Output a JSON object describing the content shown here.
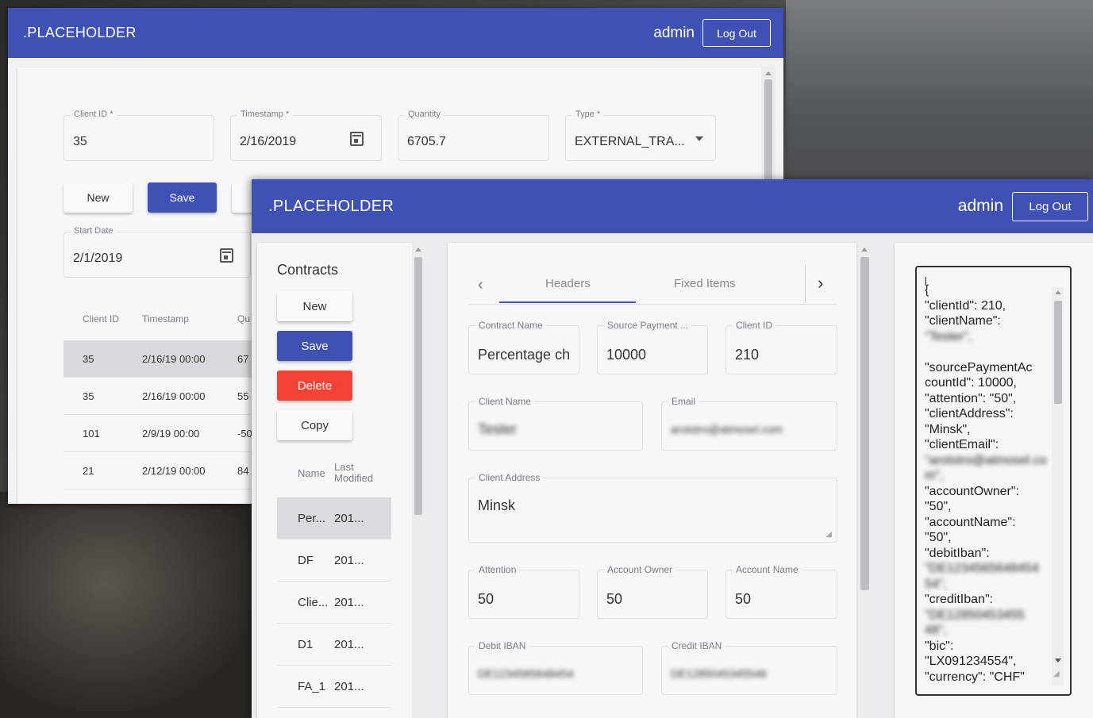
{
  "app": {
    "brand": ".PLACEHOLDER",
    "user": "admin",
    "logout_label": "Log Out"
  },
  "back": {
    "fields": {
      "client_id": {
        "label": "Client ID *",
        "value": "35"
      },
      "timestamp": {
        "label": "Timestamp *",
        "value": "2/16/2019"
      },
      "quantity": {
        "label": "Quantity",
        "value": "6705.7"
      },
      "type": {
        "label": "Type *",
        "value": "EXTERNAL_TRA..."
      },
      "start_date": {
        "label": "Start Date",
        "value": "2/1/2019"
      }
    },
    "buttons": {
      "new": "New",
      "save": "Save"
    },
    "table": {
      "headers": [
        "Client ID",
        "Timestamp",
        "Qu"
      ],
      "rows": [
        [
          "35",
          "2/16/19 00:00",
          "67"
        ],
        [
          "35",
          "2/16/19 00:00",
          "55"
        ],
        [
          "101",
          "2/9/19 00:00",
          "-50"
        ],
        [
          "21",
          "2/12/19 00:00",
          "84"
        ]
      ]
    }
  },
  "front": {
    "contracts": {
      "title": "Contracts",
      "buttons": {
        "new": "New",
        "save": "Save",
        "delete": "Delete",
        "copy": "Copy"
      },
      "headers": {
        "name": "Name",
        "last_modified_1": "Last",
        "last_modified_2": "Modified"
      },
      "rows": [
        [
          "Per...",
          "201..."
        ],
        [
          "DF",
          "201..."
        ],
        [
          "Clie...",
          "201..."
        ],
        [
          "D1",
          "201..."
        ],
        [
          "FA_1",
          "201..."
        ]
      ]
    },
    "tabs": {
      "headers": "Headers",
      "fixed_items": "Fixed Items"
    },
    "form": {
      "contract_name": {
        "label": "Contract Name",
        "value": "Percentage chi"
      },
      "source_payment": {
        "label": "Source Payment ...",
        "value": "10000"
      },
      "client_id": {
        "label": "Client ID",
        "value": "210"
      },
      "client_name": {
        "label": "Client Name",
        "value": "Tester"
      },
      "email": {
        "label": "Email",
        "value": "arotstro@atmosel.com"
      },
      "client_address": {
        "label": "Client Address",
        "value": "Minsk"
      },
      "attention": {
        "label": "Attention",
        "value": "50"
      },
      "account_owner": {
        "label": "Account Owner",
        "value": "50"
      },
      "account_name": {
        "label": "Account Name",
        "value": "50"
      },
      "debit_iban": {
        "label": "Debit IBAN",
        "value": "DE1234565648454"
      },
      "credit_iban": {
        "label": "Credit IBAN",
        "value": "DE1285045345548"
      }
    },
    "json_lines": [
      "{",
      "  \"clientId\": 210,",
      "  \"clientName\":",
      "\"Tester\",",
      "",
      "\"sourcePaymentAc",
      "countId\": 10000,",
      "  \"attention\": \"50\",",
      "  \"clientAddress\":",
      "\"Minsk\",",
      "  \"clientEmail\":",
      "\"arotstro@atmosel.co",
      "m\",",
      "  \"accountOwner\":",
      "\"50\",",
      "  \"accountName\":",
      "\"50\",",
      "  \"debitIban\":",
      "\"DE1234565648454",
      "54\",",
      "  \"creditIban\":",
      "\"DE12850453455",
      "48\",",
      "  \"bic\":",
      "\"LX091234554\",",
      "  \"currency\": \"CHF\""
    ]
  }
}
